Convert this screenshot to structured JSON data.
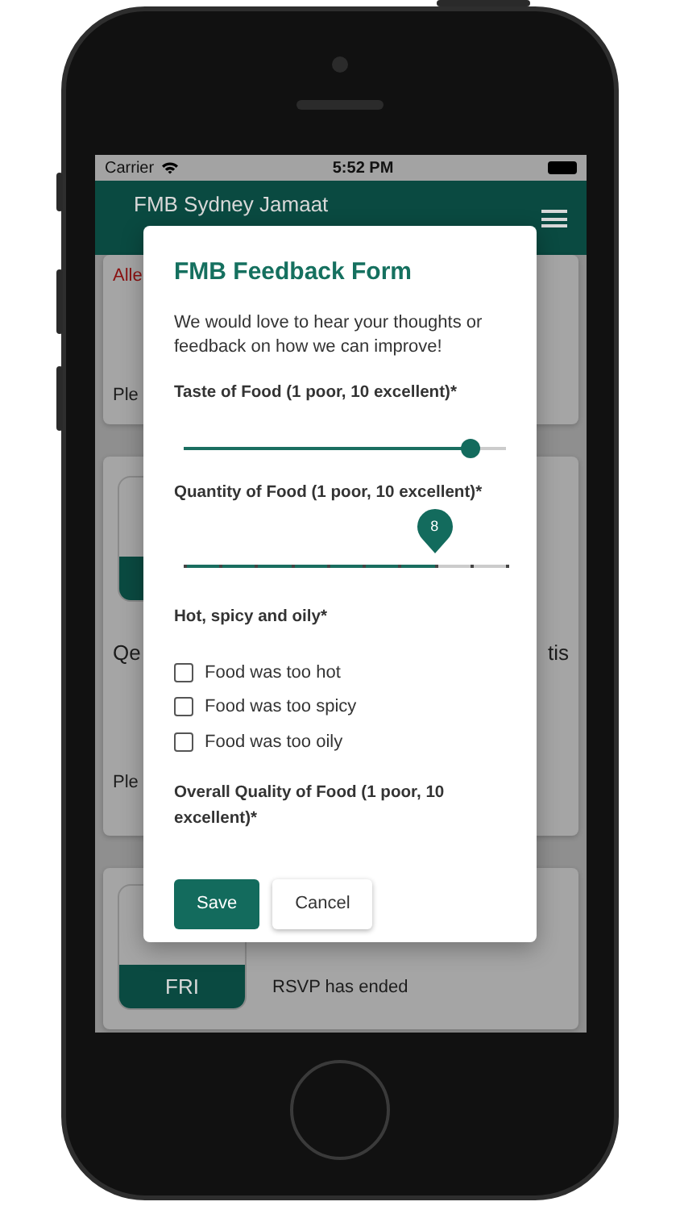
{
  "status_bar": {
    "carrier": "Carrier",
    "time": "5:52 PM"
  },
  "app_bar": {
    "title": "FMB Sydney Jamaat"
  },
  "cards": [
    {
      "kind": "alert",
      "alert": "Alle",
      "text": "Ple"
    },
    {
      "kind": "event",
      "heading_start": "Qe",
      "heading_end": "tis",
      "text": "Ple"
    },
    {
      "kind": "rsvp",
      "day": "FRI",
      "status": "RSVP has ended"
    }
  ],
  "modal": {
    "title": "FMB Feedback Form",
    "intro": "We would love to hear your thoughts or feedback on how we can improve!",
    "questions": [
      {
        "kind": "slider",
        "label": "Taste of Food (1 poor, 10 excellent)*",
        "level": 0.889,
        "active": false
      },
      {
        "kind": "slider",
        "label": "Quantity of Food (1 poor, 10 excellent)*",
        "level": 0.778,
        "active": true,
        "value_label": "8"
      },
      {
        "kind": "checkboxes",
        "label": "Hot, spicy and oily*",
        "options": [
          {
            "label": "Food was too hot",
            "checked": false
          },
          {
            "label": "Food was too spicy",
            "checked": false
          },
          {
            "label": "Food was too oily",
            "checked": false
          }
        ]
      },
      {
        "kind": "heading",
        "label": "Overall Quality of Food (1 poor, 10 excellent)*"
      }
    ],
    "buttons": [
      {
        "label": "Save",
        "kind": "primary"
      },
      {
        "label": "Cancel",
        "kind": "secondary"
      }
    ]
  }
}
